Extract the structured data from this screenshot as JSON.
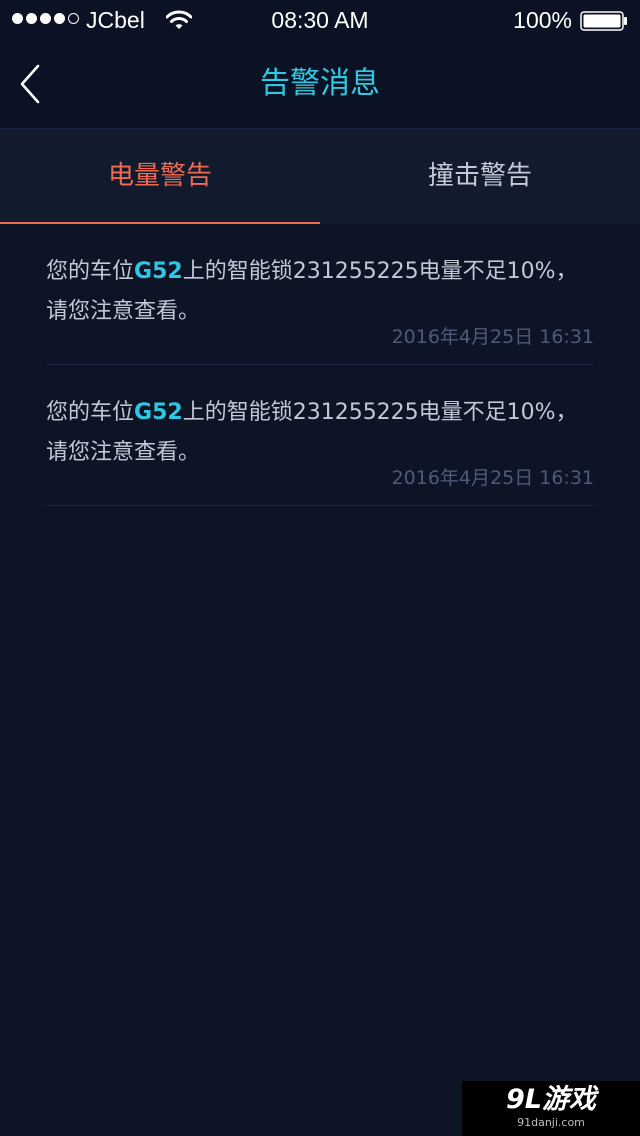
{
  "status_bar": {
    "carrier": "JCbel",
    "time": "08:30 AM",
    "battery": "100%",
    "signal_bars_filled": 4,
    "signal_bars_total": 5
  },
  "nav": {
    "title": "告警消息",
    "back_icon": "chevron-left-icon"
  },
  "tabs": [
    {
      "label": "电量警告",
      "active": true
    },
    {
      "label": "撞击警告",
      "active": false
    }
  ],
  "messages": [
    {
      "prefix": "您的车位",
      "spot": "G52",
      "suffix": "上的智能锁231255225电量不足10%，",
      "line2": "请您注意查看。",
      "time": "2016年4月25日 16:31"
    },
    {
      "prefix": "您的车位",
      "spot": "G52",
      "suffix": "上的智能锁231255225电量不足10%，",
      "line2": "请您注意查看。",
      "time": "2016年4月25日 16:31"
    }
  ],
  "watermark": {
    "logo": "9L游戏",
    "url": "91danji.com"
  },
  "colors": {
    "background": "#0c1426",
    "accent": "#2fc7e2",
    "active_tab": "#ee6a50",
    "text": "#c3c8d3",
    "timestamp": "#4e5b77"
  }
}
